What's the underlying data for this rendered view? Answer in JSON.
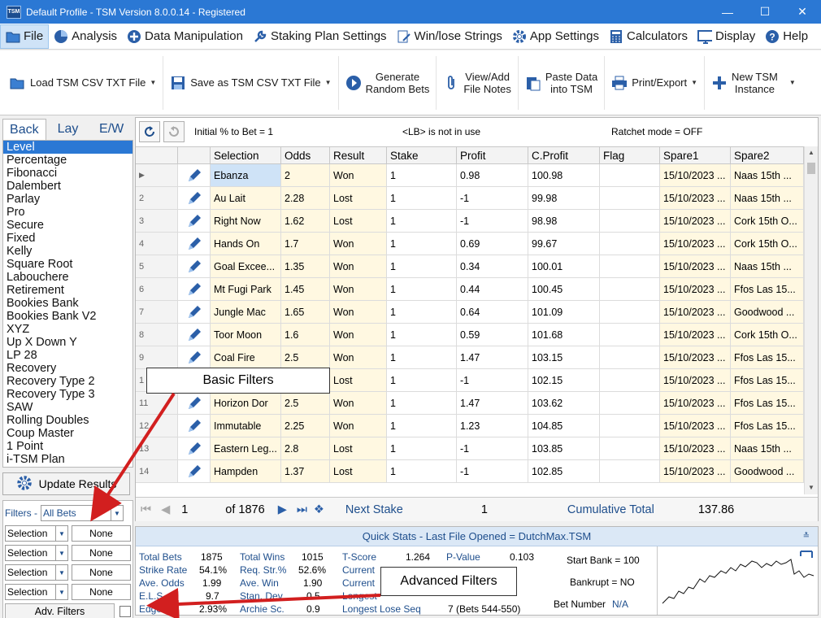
{
  "window": {
    "app_icon": "TSM",
    "title": "Default Profile  -  TSM Version 8.0.0.14 - Registered"
  },
  "menu": [
    {
      "label": "File",
      "icon": "folder-icon"
    },
    {
      "label": "Analysis",
      "icon": "pie-chart-icon"
    },
    {
      "label": "Data Manipulation",
      "icon": "plus-circle-icon"
    },
    {
      "label": "Staking Plan Settings",
      "icon": "wrench-icon"
    },
    {
      "label": "Win/lose Strings",
      "icon": "document-edit-icon"
    },
    {
      "label": "App Settings",
      "icon": "gear-icon"
    },
    {
      "label": "Calculators",
      "icon": "calculator-icon"
    },
    {
      "label": "Display",
      "icon": "monitor-icon"
    },
    {
      "label": "Help",
      "icon": "help-icon"
    }
  ],
  "toolbar": {
    "load": "Load TSM CSV TXT File",
    "save": "Save as TSM CSV TXT File",
    "gen1": "Generate",
    "gen2": "Random Bets",
    "notes1": "View/Add",
    "notes2": "File Notes",
    "paste1": "Paste Data",
    "paste2": "into TSM",
    "print": "Print/Export",
    "new1": "New TSM",
    "new2": "Instance"
  },
  "mode_tabs": [
    "Back",
    "Lay",
    "E/W"
  ],
  "plans": [
    "Level",
    "Percentage",
    "Fibonacci",
    "Dalembert",
    "Parlay",
    "Pro",
    "Secure",
    "Fixed",
    "Kelly",
    "Square Root",
    "Labouchere",
    "Retirement",
    "Bookies Bank",
    "Bookies Bank V2",
    "XYZ",
    "Up X Down Y",
    "LP 28",
    "Recovery",
    "Recovery Type 2",
    "Recovery Type 3",
    "SAW",
    "Rolling Doubles",
    "Coup Master",
    "1 Point",
    "i-TSM Plan"
  ],
  "update_button": "Update Results",
  "filters": {
    "label": "Filters -",
    "value": "All Bets",
    "rows": [
      {
        "field": "Selection",
        "value": "None"
      },
      {
        "field": "Selection",
        "value": "None"
      },
      {
        "field": "Selection",
        "value": "None"
      },
      {
        "field": "Selection",
        "value": "None"
      }
    ],
    "adv_button": "Adv. Filters"
  },
  "info": {
    "initial": "Initial % to Bet = 1",
    "lb": "<LB> is not in use",
    "ratchet": "Ratchet mode = OFF"
  },
  "columns": [
    "Selection",
    "Odds",
    "Result",
    "Stake",
    "Profit",
    "C.Profit",
    "Flag",
    "Spare1",
    "Spare2"
  ],
  "rows": [
    {
      "n": "",
      "sel": "Ebanza",
      "odds": "2",
      "res": "Won",
      "stake": "1",
      "profit": "0.98",
      "cp": "100.98",
      "flag": "",
      "s1": "15/10/2023 ...",
      "s2": "Naas 15th ..."
    },
    {
      "n": "2",
      "sel": "Au Lait",
      "odds": "2.28",
      "res": "Lost",
      "stake": "1",
      "profit": "-1",
      "cp": "99.98",
      "flag": "",
      "s1": "15/10/2023 ...",
      "s2": "Naas 15th ..."
    },
    {
      "n": "3",
      "sel": "Right Now",
      "odds": "1.62",
      "res": "Lost",
      "stake": "1",
      "profit": "-1",
      "cp": "98.98",
      "flag": "",
      "s1": "15/10/2023 ...",
      "s2": "Cork 15th O..."
    },
    {
      "n": "4",
      "sel": "Hands On",
      "odds": "1.7",
      "res": "Won",
      "stake": "1",
      "profit": "0.69",
      "cp": "99.67",
      "flag": "",
      "s1": "15/10/2023 ...",
      "s2": "Cork 15th O..."
    },
    {
      "n": "5",
      "sel": "Goal Excee...",
      "odds": "1.35",
      "res": "Won",
      "stake": "1",
      "profit": "0.34",
      "cp": "100.01",
      "flag": "",
      "s1": "15/10/2023 ...",
      "s2": "Naas 15th ..."
    },
    {
      "n": "6",
      "sel": "Mt Fugi Park",
      "odds": "1.45",
      "res": "Won",
      "stake": "1",
      "profit": "0.44",
      "cp": "100.45",
      "flag": "",
      "s1": "15/10/2023 ...",
      "s2": "Ffos Las 15..."
    },
    {
      "n": "7",
      "sel": "Jungle Mac",
      "odds": "1.65",
      "res": "Won",
      "stake": "1",
      "profit": "0.64",
      "cp": "101.09",
      "flag": "",
      "s1": "15/10/2023 ...",
      "s2": "Goodwood ..."
    },
    {
      "n": "8",
      "sel": "Toor Moon",
      "odds": "1.6",
      "res": "Won",
      "stake": "1",
      "profit": "0.59",
      "cp": "101.68",
      "flag": "",
      "s1": "15/10/2023 ...",
      "s2": "Cork 15th O..."
    },
    {
      "n": "9",
      "sel": "Coal Fire",
      "odds": "2.5",
      "res": "Won",
      "stake": "1",
      "profit": "1.47",
      "cp": "103.15",
      "flag": "",
      "s1": "15/10/2023 ...",
      "s2": "Ffos Las 15..."
    },
    {
      "n": "1",
      "sel": "",
      "odds": "",
      "res": "Lost",
      "stake": "1",
      "profit": "-1",
      "cp": "102.15",
      "flag": "",
      "s1": "15/10/2023 ...",
      "s2": "Ffos Las 15..."
    },
    {
      "n": "11",
      "sel": "Horizon Dor",
      "odds": "2.5",
      "res": "Won",
      "stake": "1",
      "profit": "1.47",
      "cp": "103.62",
      "flag": "",
      "s1": "15/10/2023 ...",
      "s2": "Ffos Las 15..."
    },
    {
      "n": "12",
      "sel": "Immutable",
      "odds": "2.25",
      "res": "Won",
      "stake": "1",
      "profit": "1.23",
      "cp": "104.85",
      "flag": "",
      "s1": "15/10/2023 ...",
      "s2": "Ffos Las 15..."
    },
    {
      "n": "13",
      "sel": "Eastern Leg...",
      "odds": "2.8",
      "res": "Lost",
      "stake": "1",
      "profit": "-1",
      "cp": "103.85",
      "flag": "",
      "s1": "15/10/2023 ...",
      "s2": "Naas 15th ..."
    },
    {
      "n": "14",
      "sel": "Hampden",
      "odds": "1.37",
      "res": "Lost",
      "stake": "1",
      "profit": "-1",
      "cp": "102.85",
      "flag": "",
      "s1": "15/10/2023 ...",
      "s2": "Goodwood ..."
    }
  ],
  "pager": {
    "page": "1",
    "of": "of 1876",
    "next_stake_label": "Next Stake",
    "next_stake": "1",
    "cum_label": "Cumulative Total",
    "cum": "137.86"
  },
  "quick_stats": {
    "title": "Quick Stats - Last File Opened = DutchMax.TSM",
    "total_bets_l": "Total Bets",
    "total_bets": "1875",
    "strike_l": "Strike Rate",
    "strike": "54.1%",
    "avg_odds_l": "Ave. Odds",
    "avg_odds": "1.99",
    "els_l": "E.L.S.",
    "els": "9.7",
    "edge_l": "Edge",
    "edge": "2.93%",
    "wins_l": "Total Wins",
    "wins": "1015",
    "req_l": "Req. Str.%",
    "req": "52.6%",
    "avewin_l": "Ave. Win",
    "avewin": "1.90",
    "stdev_l": "Stan. Dev.",
    "stdev": "0.5",
    "archie_l": "Archie Sc.",
    "archie": "0.9",
    "tscore_l": "T-Score",
    "tscore": "1.264",
    "pval_l": "P-Value",
    "pval": "0.103",
    "cur1_l": "Current",
    "cur2_l": "Current",
    "longest_l": "Longest",
    "lls_l": "Longest Lose Seq",
    "lls": "7  (Bets 544-550)",
    "start_bank": "Start Bank = 100",
    "bankrupt": "Bankrupt = NO",
    "bet_number_l": "Bet Number",
    "bet_number": "N/A"
  },
  "callouts": {
    "basic": "Basic Filters",
    "advanced": "Advanced Filters"
  },
  "colors": {
    "accent": "#2b78d4",
    "link": "#1e4e8c",
    "arrow": "#d21f1f",
    "highlight": "#fff8e1"
  }
}
